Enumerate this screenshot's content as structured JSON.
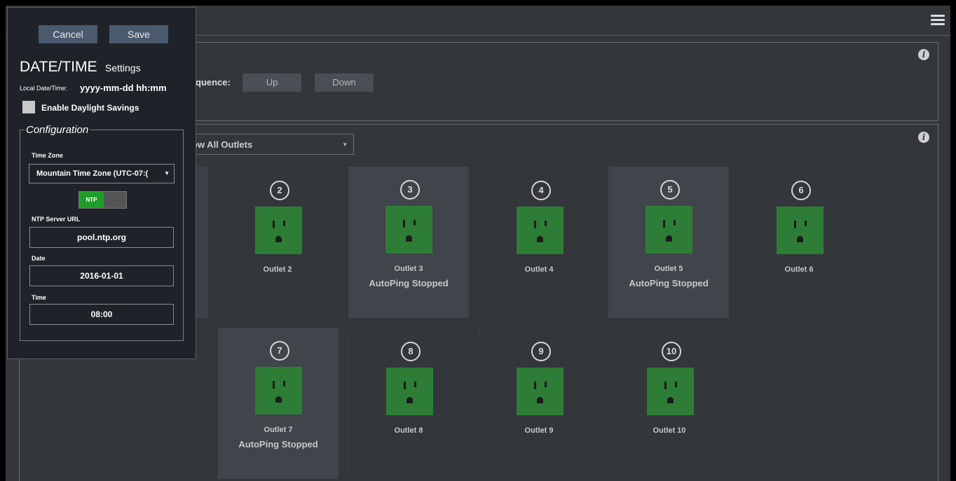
{
  "header": {
    "menu_icon": "hamburger-menu-icon"
  },
  "sequence": {
    "label": "quence:",
    "up_label": "Up",
    "down_label": "Down"
  },
  "filter": {
    "value": "ow All Outlets"
  },
  "outlets": [
    {
      "number": "2",
      "name": "Outlet 2",
      "status": ""
    },
    {
      "number": "3",
      "name": "Outlet 3",
      "status": "AutoPing Stopped"
    },
    {
      "number": "4",
      "name": "Outlet 4",
      "status": ""
    },
    {
      "number": "5",
      "name": "Outlet 5",
      "status": "AutoPing Stopped"
    },
    {
      "number": "6",
      "name": "Outlet 6",
      "status": ""
    },
    {
      "number": "7",
      "name": "Outlet 7",
      "status": "AutoPing Stopped"
    },
    {
      "number": "8",
      "name": "Outlet 8",
      "status": ""
    },
    {
      "number": "9",
      "name": "Outlet 9",
      "status": ""
    },
    {
      "number": "10",
      "name": "Outlet 10",
      "status": ""
    }
  ],
  "dialog": {
    "cancel_label": "Cancel",
    "save_label": "Save",
    "title": "DATE/TIME",
    "subtitle": "Settings",
    "local_datetime_label": "Local Date/Time:",
    "local_datetime_value": "yyyy-mm-dd hh:mm",
    "daylight_label": "Enable Daylight Savings",
    "config_legend": "Configuration",
    "timezone_label": "Time Zone",
    "timezone_value": "Mountain Time Zone (UTC-07:(",
    "ntp_toggle_label": "NTP",
    "ntp_url_label": "NTP Server URL",
    "ntp_url_value": "pool.ntp.org",
    "date_label": "Date",
    "date_value": "2016-01-01",
    "time_label": "Time",
    "time_value": "08:00"
  },
  "colors": {
    "outlet_on": "#2e7d36",
    "ntp_on": "#1d9e2a",
    "background": "#33363b",
    "dialog_bg": "#1f2329"
  }
}
